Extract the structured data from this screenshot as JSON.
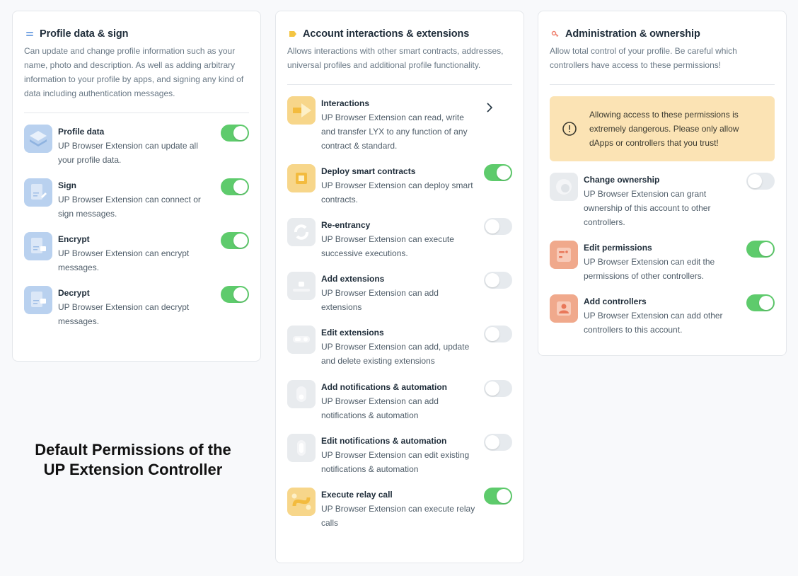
{
  "profile": {
    "title": "Profile data & sign",
    "description": "Can update and change profile information such as your name, photo and description. As well as adding arbitrary information to your profile by apps, and signing any kind of data including authentication messages.",
    "items": [
      {
        "title": "Profile data",
        "description": "UP Browser Extension can update all your profile data.",
        "enabled": true,
        "icon": "layers-icon"
      },
      {
        "title": "Sign",
        "description": "UP Browser Extension can connect or sign messages.",
        "enabled": true,
        "icon": "sign-document-icon"
      },
      {
        "title": "Encrypt",
        "description": "UP Browser Extension can encrypt messages.",
        "enabled": true,
        "icon": "encrypt-document-icon"
      },
      {
        "title": "Decrypt",
        "description": "UP Browser Extension can decrypt messages.",
        "enabled": true,
        "icon": "decrypt-document-icon"
      }
    ]
  },
  "account": {
    "title": "Account interactions & extensions",
    "description": "Allows interactions with other smart contracts, addresses, universal profiles and additional profile functionality.",
    "items": [
      {
        "title": "Interactions",
        "description": "UP Browser Extension can read, write and transfer LYX to any function of any contract & standard.",
        "control": "chevron",
        "icon": "interactions-icon"
      },
      {
        "title": "Deploy smart contracts",
        "description": "UP Browser Extension can deploy smart contracts.",
        "enabled": true,
        "icon": "deploy-icon"
      },
      {
        "title": "Re-entrancy",
        "description": "UP Browser Extension can execute successive executions.",
        "enabled": false,
        "icon": "reentrancy-icon"
      },
      {
        "title": "Add extensions",
        "description": "UP Browser Extension can add extensions",
        "enabled": false,
        "icon": "add-extensions-icon"
      },
      {
        "title": "Edit extensions",
        "description": "UP Browser Extension can add, update and delete existing extensions",
        "enabled": false,
        "icon": "edit-extensions-icon"
      },
      {
        "title": "Add notifications & automation",
        "description": "UP Browser Extension can add notifications & automation",
        "enabled": false,
        "icon": "add-notifications-icon"
      },
      {
        "title": "Edit notifications & automation",
        "description": "UP Browser Extension can edit existing notifications & automation",
        "enabled": false,
        "icon": "edit-notifications-icon"
      },
      {
        "title": "Execute relay call",
        "description": "UP Browser Extension can execute relay calls",
        "enabled": true,
        "icon": "relay-call-icon"
      }
    ]
  },
  "admin": {
    "title": "Administration & ownership",
    "description": "Allow total control of your profile. Be careful which controllers have access to these permissions!",
    "warning": "Allowing access to these permissions is extremely dangerous. Please only allow dApps or controllers that you trust!",
    "items": [
      {
        "title": "Change ownership",
        "description": "UP Browser Extension can grant ownership of this account to other controllers.",
        "enabled": false,
        "icon": "ownership-icon"
      },
      {
        "title": "Edit permissions",
        "description": "UP Browser Extension can edit the permissions of other controllers.",
        "enabled": true,
        "icon": "edit-permissions-icon"
      },
      {
        "title": "Add controllers",
        "description": "UP Browser Extension can add other controllers to this account.",
        "enabled": true,
        "icon": "add-controllers-icon"
      }
    ]
  },
  "caption": {
    "line1": "Default Permissions of the",
    "line2": "UP Extension Controller"
  },
  "colors": {
    "toggle_on": "#5ecb6c",
    "toggle_off": "#e6eaee",
    "warning_bg": "#fbe3b4"
  }
}
